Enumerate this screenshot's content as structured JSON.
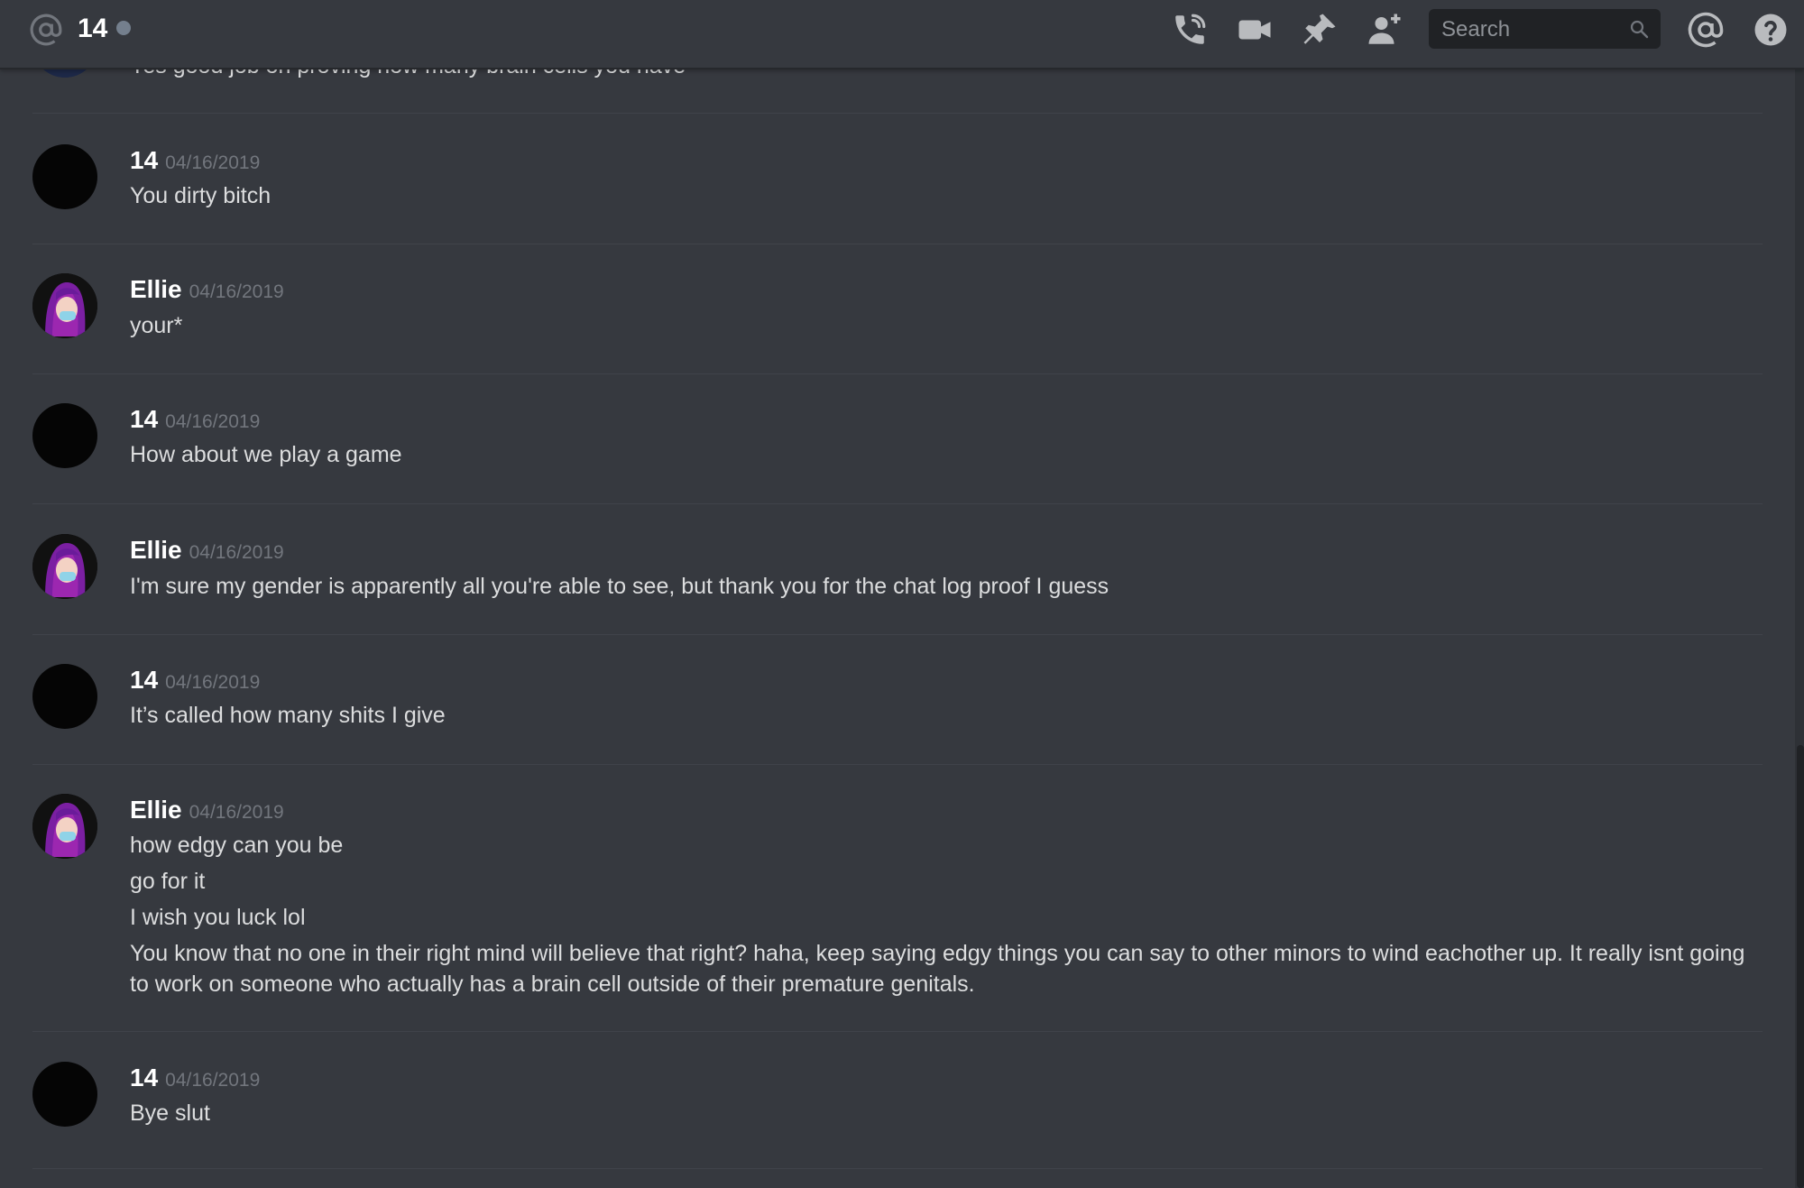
{
  "header": {
    "channel_name": "14",
    "search_placeholder": "Search",
    "icons": [
      "at-icon",
      "phone-call-icon",
      "video-icon",
      "pin-icon",
      "add-friend-icon",
      "search-icon",
      "mention-icon",
      "help-icon"
    ]
  },
  "messages": [
    {
      "author": "",
      "timestamp": "",
      "lines": [
        "Yes good job on proving how many brain cells you have"
      ]
    },
    {
      "author": "14",
      "timestamp": "04/16/2019",
      "lines": [
        "You dirty bitch"
      ]
    },
    {
      "author": "Ellie",
      "timestamp": "04/16/2019",
      "lines": [
        "your*"
      ]
    },
    {
      "author": "14",
      "timestamp": "04/16/2019",
      "lines": [
        "How about we play a game"
      ]
    },
    {
      "author": "Ellie",
      "timestamp": "04/16/2019",
      "lines": [
        "I'm sure my gender is apparently all you're able to see, but thank you for the chat log proof I guess"
      ]
    },
    {
      "author": "14",
      "timestamp": "04/16/2019",
      "lines": [
        "It’s called how many shits I give"
      ]
    },
    {
      "author": "Ellie",
      "timestamp": "04/16/2019",
      "lines": [
        "how edgy can you be",
        "go for it",
        "I wish you luck lol",
        "You know that no one in their right mind will believe that right? haha, keep  saying edgy things you can say to other minors to wind eachother up. It really isnt going to work on someone who actually has a brain cell outside of their premature genitals."
      ]
    },
    {
      "author": "14",
      "timestamp": "04/16/2019",
      "lines": [
        "Bye slut"
      ]
    }
  ],
  "colors": {
    "background": "#36393f",
    "author": "#ffffff",
    "timestamp": "#72767d",
    "message_text": "#dcddde",
    "ellie_avatar_accent": "#8a2be2"
  }
}
